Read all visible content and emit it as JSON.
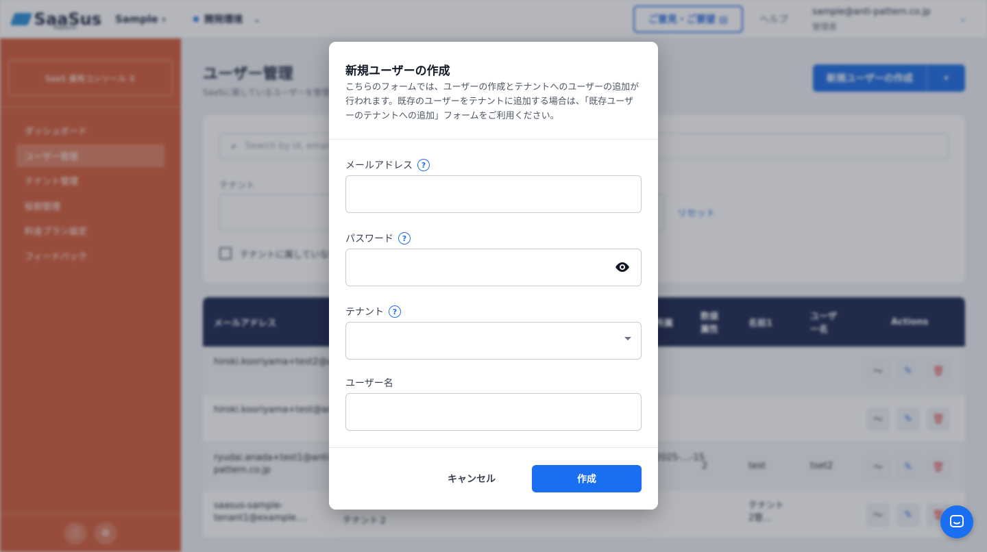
{
  "app": {
    "logo_text": "SaaSus",
    "logo_sub": "Platform",
    "breadcrumb": "Sample ›",
    "env": "開発環境",
    "feedback": "ご意見・ご要望 ▤",
    "help": "ヘルプ",
    "user_email": "sample@anti-pattern.co.jp",
    "user_role": "管理者"
  },
  "sidebar": {
    "console_label": "SaaS 運用コンソール ⇕",
    "items": [
      {
        "label": "ダッシュボード"
      },
      {
        "label": "ユーザー管理"
      },
      {
        "label": "テナント管理"
      },
      {
        "label": "役割管理"
      },
      {
        "label": "料金プラン設定"
      },
      {
        "label": "フィードバック"
      }
    ]
  },
  "main": {
    "title": "ユーザー管理",
    "description": "SaaSに属しているユーザーを管理します。ユーザーは複数のテナントに属することが可能です。",
    "new_user_button": "新規ユーザーの作成",
    "search_placeholder": "Search by id, email",
    "tenant_label": "テナント",
    "reset": "リセット",
    "checkbox_label": "テナントに属していないユーザーを表示",
    "table": {
      "headers": {
        "email": "メールアドレス",
        "col_attr": "所属",
        "num_attr": "数値属性",
        "name1": "名前1",
        "username": "ユーザー名",
        "actions": "Actions"
      },
      "rows": [
        {
          "email": "hiroki.kooriyama+test2@anti-...",
          "num": "",
          "name1": "",
          "username": ""
        },
        {
          "email": "hiroki.kooriyama+test@anti-...",
          "num": "",
          "name1": "",
          "username": ""
        },
        {
          "email": "ryudai.anada+test1@anti-pattern.co.jp",
          "date": "2025-…-15",
          "num": "2",
          "name1": "test",
          "username": "tset2"
        },
        {
          "email": "saasus-sample-tenant1@example....",
          "tenant": "テナント２",
          "num": "",
          "name1": "テナント2管...",
          "username": ""
        }
      ]
    }
  },
  "modal": {
    "title": "新規ユーザーの作成",
    "description": "こちらのフォームでは、ユーザーの作成とテナントへのユーザーの追加が行われます。既存のユーザーをテナントに追加する場合は、「既存ユーザーのテナントへの追加」フォームをご利用ください。",
    "email_label": "メールアドレス",
    "email_value": "",
    "password_label": "パスワード",
    "password_value": "",
    "tenant_label": "テナント",
    "tenant_value": "",
    "username_label": "ユーザー名",
    "username_value": "",
    "cancel": "キャンセル",
    "create": "作成"
  },
  "colors": {
    "accent": "#1a6ff0",
    "sidebar": "#d45f3c",
    "table_header": "#1c2a52"
  }
}
